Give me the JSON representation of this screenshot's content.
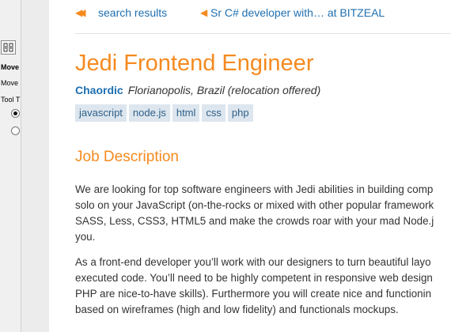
{
  "left_panel": {
    "label1": "Move",
    "label2": "Move",
    "label3": "Tool T"
  },
  "nav": {
    "back_label": "search results",
    "prev_label": "Sr C# developer with… at BITZEAL"
  },
  "job": {
    "title": "Jedi Frontend Engineer",
    "company": "Chaordic",
    "location": "Florianopolis, Brazil (relocation offered)",
    "tags": [
      "javascript",
      "node.js",
      "html",
      "css",
      "php"
    ]
  },
  "description": {
    "heading": "Job Description",
    "p1_lines": [
      "We are looking for top software engineers with Jedi abilities in building comp",
      "solo on your JavaScript (on-the-rocks or mixed with other popular framework",
      "SASS, Less, CSS3, HTML5 and make the crowds roar with your mad Node.j",
      "you."
    ],
    "p2_lines": [
      "As a front-end developer you’ll work with our designers to turn beautiful layo",
      "executed code. You’ll need to be highly competent in responsive web design",
      "PHP are nice-to-have skills). Furthermore you will create nice and functionin",
      "based on wireframes (high and low fidelity) and functionals mockups."
    ]
  },
  "colors": {
    "accent_orange": "#f58a1f",
    "link_blue": "#1f6fb0",
    "tag_bg": "#dde6ee"
  }
}
